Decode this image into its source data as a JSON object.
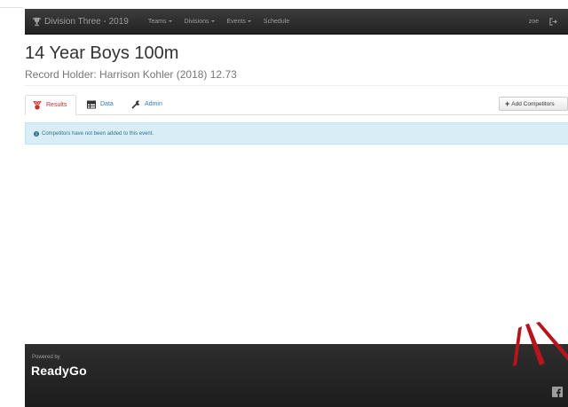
{
  "navbar": {
    "brand": "Division Three - 2019",
    "items": [
      {
        "label": "Teams",
        "dropdown": true
      },
      {
        "label": "Divisions",
        "dropdown": true
      },
      {
        "label": "Events",
        "dropdown": true
      },
      {
        "label": "Schedule",
        "dropdown": false
      }
    ],
    "user": "zoe",
    "icons": {
      "brand": "trophy-icon",
      "logout": "sign-out-icon"
    }
  },
  "header": {
    "title": "14 Year Boys 100m",
    "subtitle": "Record Holder: Harrison Kohler (2018) 12.73"
  },
  "tabs": [
    {
      "label": "Results",
      "icon": "medal-icon",
      "active": true
    },
    {
      "label": "Data",
      "icon": "table-icon",
      "active": false
    },
    {
      "label": "Admin",
      "icon": "wrench-icon",
      "active": false
    }
  ],
  "actions": {
    "add_competitors": "Add Competitors"
  },
  "alert": {
    "message": "Competitors have not been added to this event."
  },
  "footer": {
    "powered_by": "Powered by",
    "logo": "ReadyGo",
    "icons": {
      "social": "facebook-icon"
    }
  },
  "colors": {
    "navbar": "#222222",
    "active_tab": "#c9302c",
    "link": "#337ab7",
    "alert_bg": "#d9edf7",
    "alert_text": "#31708f",
    "accent_red": "#b8141b"
  }
}
